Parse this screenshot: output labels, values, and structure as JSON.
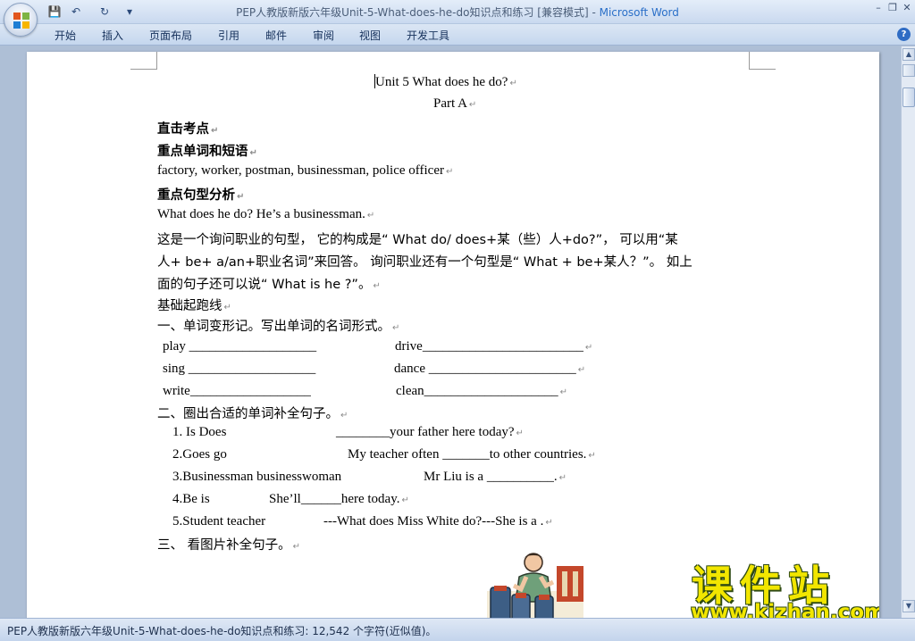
{
  "window": {
    "title_doc": "PEP人教版新版六年级Unit-5-What-does-he-do知识点和练习 [兼容模式]",
    "title_sep": " - ",
    "title_app": "Microsoft Word",
    "controls": {
      "minimize": "–",
      "restore": "❐",
      "close": "✕"
    }
  },
  "quick_access": {
    "save": "💾",
    "undo": "↶",
    "redo": "↻",
    "customize": "▾"
  },
  "ribbon_tabs": [
    "开始",
    "插入",
    "页面布局",
    "引用",
    "邮件",
    "审阅",
    "视图",
    "开发工具"
  ],
  "help": "?",
  "document": {
    "title": "Unit 5 What does he do?",
    "subtitle": "Part A",
    "h_focus": "直击考点",
    "h_words": "重点单词和短语",
    "words": "factory, worker, postman, businessman, police officer",
    "h_sentence": "重点句型分析",
    "sentence": "What does he do? He’s a businessman.",
    "explain1": "这是一个询问职业的句型，  它的构成是“  What do/ does+某（些）人+do?”，  可以用“某",
    "explain2": "人+ be+ a/an+职业名词”来回答。  询问职业还有一个句型是“  What + be+某人？”。  如上",
    "explain3": "面的句子还可以说“  What is he ?”。",
    "basics": "基础起跑线",
    "ex1_title": "一、单词变形记。写出单词的名词形式。",
    "ex1_rows": [
      {
        "a": "play ___________________",
        "b": "drive________________________"
      },
      {
        "a": "sing ___________________",
        "b": "dance ______________________"
      },
      {
        "a": "write__________________",
        "b": "clean____________________"
      }
    ],
    "ex2_title": "二、圈出合适的单词补全句子。",
    "ex2_items": [
      {
        "opts": "1.    Is     Does",
        "text": "________your father here today?"
      },
      {
        "opts": "2.Goes          go",
        "text": "My teacher often _______to other countries."
      },
      {
        "opts": "3.Businessman     businesswoman",
        "text": "Mr Liu is a __________."
      },
      {
        "opts": "4.Be      is",
        "text": "She’ll______here today."
      },
      {
        "opts": "5.Student      teacher",
        "text": "---What does Miss White do?---She is a ."
      }
    ],
    "ex3_title": "三、 看图片补全句子。"
  },
  "watermark": {
    "cn": "课件站",
    "url": "www.kjzhan.com"
  },
  "status": {
    "text": "PEP人教版新版六年级Unit-5-What-does-he-do知识点和练习: 12,542 个字符(近似值)。"
  },
  "scrollbar": {
    "up": "▲",
    "down": "▼"
  },
  "colors": {
    "accent": "#2a6fc8",
    "workspace": "#aebfd6",
    "watermark": "#f2e600"
  }
}
